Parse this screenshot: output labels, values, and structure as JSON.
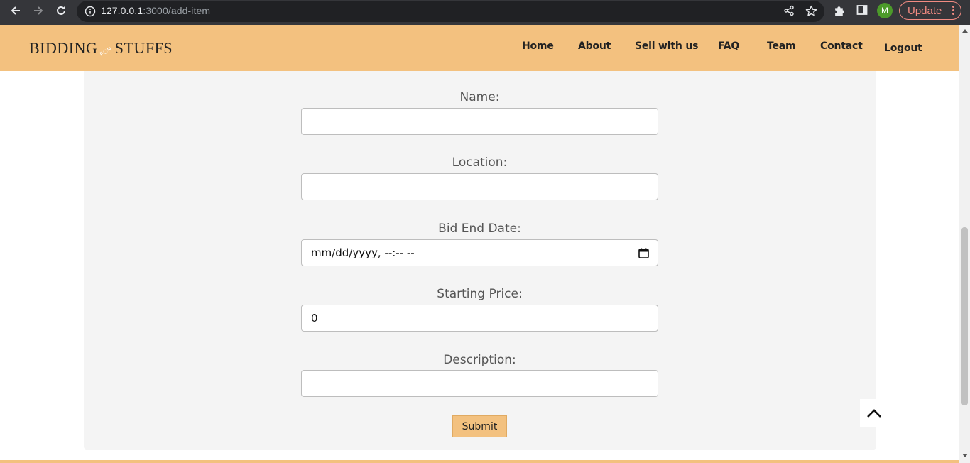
{
  "browser": {
    "url_host": "127.0.0.1",
    "url_path": ":3000/add-item",
    "profile_initial": "M",
    "update_label": "Update"
  },
  "header": {
    "logo_left": "BIDDING",
    "logo_mid": "FOR",
    "logo_right": "STUFFS",
    "nav": [
      "Home",
      "About",
      "Sell with us",
      "FAQ",
      "Team",
      "Contact"
    ],
    "logout": "Logout"
  },
  "form": {
    "name_label": "Name:",
    "name_value": "",
    "location_label": "Location:",
    "location_value": "",
    "bid_end_label": "Bid End Date:",
    "bid_end_value": "mm/dd/yyyy, --:-- --",
    "price_label": "Starting Price:",
    "price_value": "0",
    "description_label": "Description:",
    "description_value": "",
    "submit_label": "Submit"
  },
  "colors": {
    "accent": "#f3c17f",
    "chrome": "#35363a",
    "card": "#f4f4f4"
  }
}
